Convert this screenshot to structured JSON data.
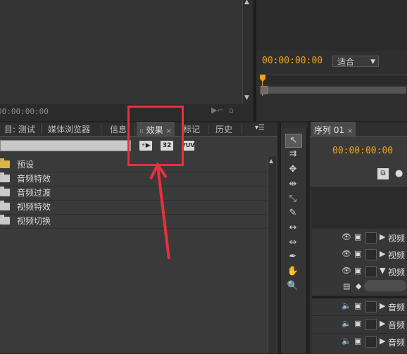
{
  "top_left": {
    "timecode": "00:00:00:00"
  },
  "program": {
    "timecode": "00:00:00:00",
    "fit_select": "适合"
  },
  "project_panel": {
    "tabs": [
      {
        "label": "目: 测试"
      },
      {
        "label": "媒体浏览器"
      },
      {
        "label": "信息"
      },
      {
        "label": "效果",
        "active": true
      },
      {
        "label": "标记"
      },
      {
        "label": "历史"
      }
    ],
    "effects_search_placeholder": "",
    "effect_buttons": [
      "accelerated",
      "32",
      "YUV"
    ],
    "items": [
      {
        "label": "预设",
        "icon": "folder-preset-icon"
      },
      {
        "label": "音频特效",
        "icon": "folder-icon"
      },
      {
        "label": "音频过渡",
        "icon": "folder-icon"
      },
      {
        "label": "视频特效",
        "icon": "folder-icon"
      },
      {
        "label": "视频切换",
        "icon": "folder-icon"
      }
    ]
  },
  "timeline": {
    "tab": "序列 01",
    "timecode": "00:00:00:00",
    "tracks": [
      {
        "name": "视频",
        "type": "video"
      },
      {
        "name": "视频",
        "type": "video"
      },
      {
        "name": "视频",
        "type": "video",
        "expanded": true
      },
      {
        "name": "音频",
        "type": "audio"
      },
      {
        "name": "音频",
        "type": "audio"
      },
      {
        "name": "音频",
        "type": "audio"
      }
    ]
  },
  "colors": {
    "accent_timecode": "#f0a21a",
    "annotation": "#e8303a"
  }
}
